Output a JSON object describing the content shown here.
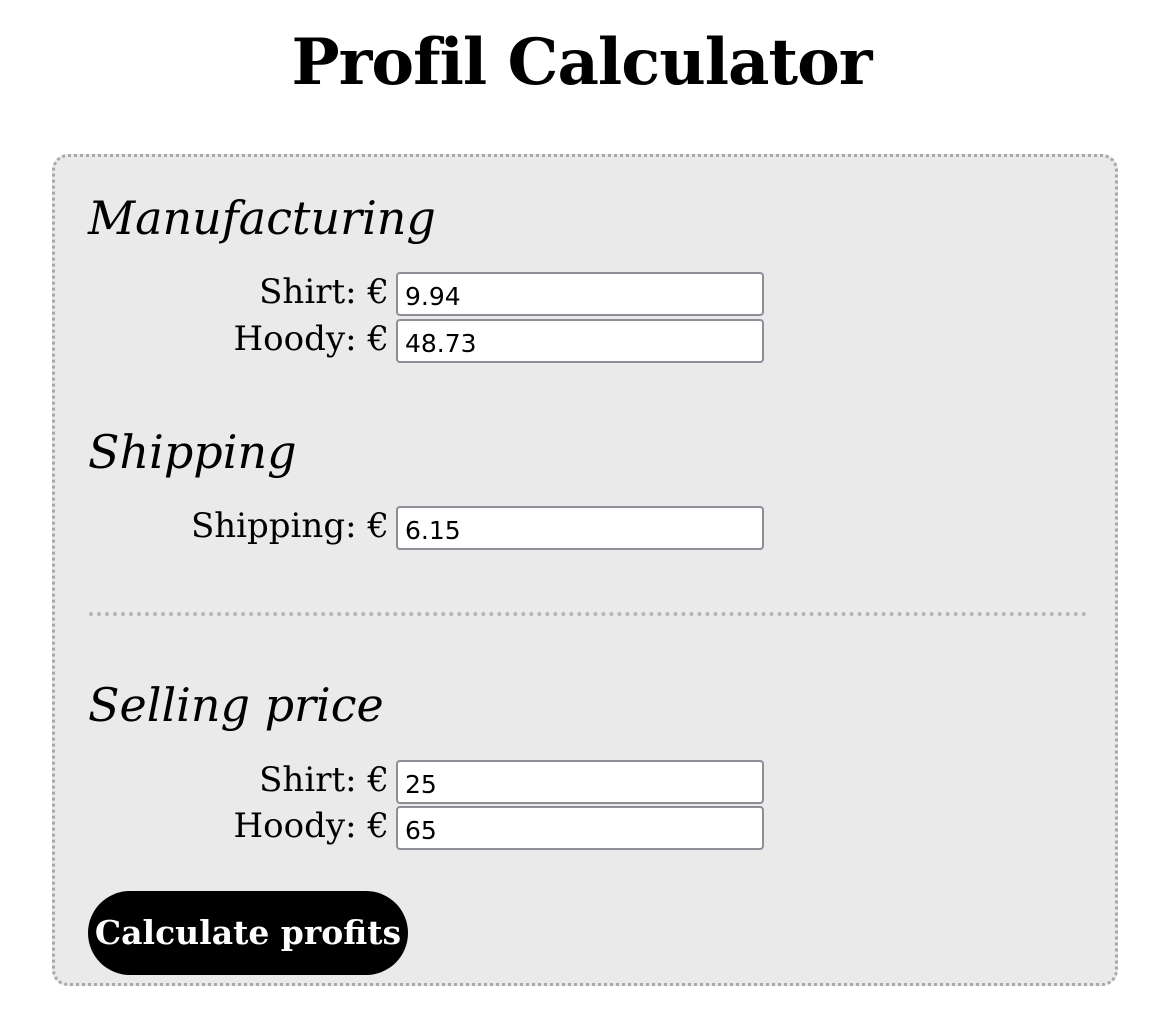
{
  "page": {
    "title": "Profil Calculator"
  },
  "manufacturing": {
    "heading": "Manufacturing",
    "shirt_label": "Shirt: €",
    "shirt_value": "9.94",
    "hoody_label": "Hoody: €",
    "hoody_value": "48.73"
  },
  "shipping": {
    "heading": "Shipping",
    "shipping_label": "Shipping: €",
    "shipping_value": "6.15"
  },
  "selling": {
    "heading": "Selling price",
    "shirt_label": "Shirt: €",
    "shirt_value": "25",
    "hoody_label": "Hoody: €",
    "hoody_value": "65"
  },
  "actions": {
    "calculate_label": "Calculate profits"
  },
  "colors": {
    "card_background": "#eaeaea",
    "card_border": "#a8a8a8",
    "button_background": "#000000",
    "button_text": "#ffffff"
  }
}
